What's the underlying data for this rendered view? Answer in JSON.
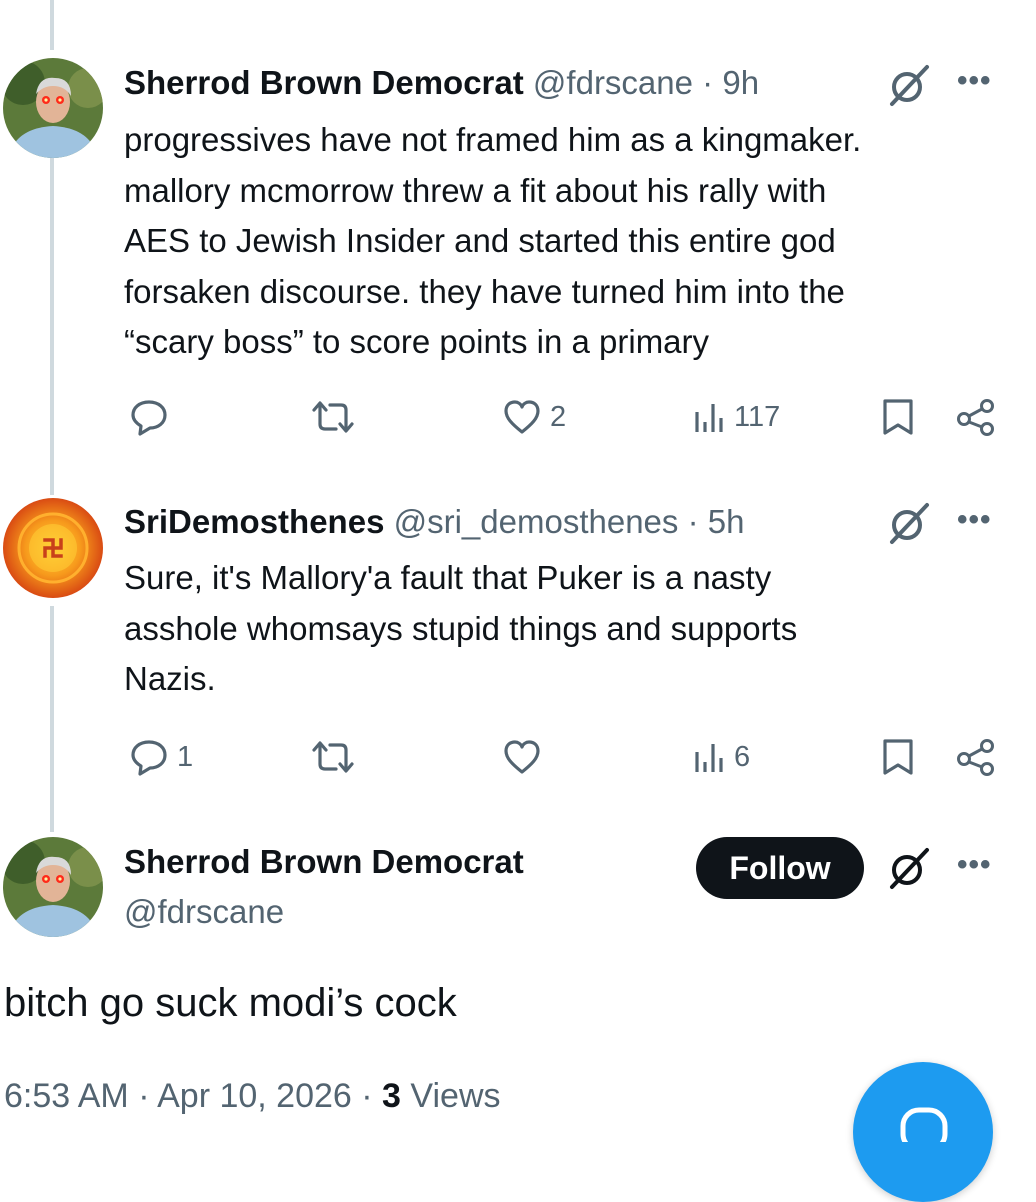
{
  "tweets": [
    {
      "name": "Sherrod Brown Democrat",
      "handle": "@fdrscane",
      "time": "9h",
      "text_lines": [
        "progressives have not framed him as a kingmaker.",
        "mallory mcmorrow threw a fit about his rally with",
        "AES to Jewish Insider and started this entire god",
        "forsaken discourse. they have turned him into the",
        "“scary boss” to score points in a primary"
      ],
      "replies": "",
      "reposts": "",
      "likes": "2",
      "views": "117"
    },
    {
      "name": "SriDemosthenes",
      "handle": "@sri_demosthenes",
      "time": "5h",
      "text_lines": [
        "Sure, it's Mallory'a fault that Puker is a nasty",
        "asshole whomsays stupid things and supports",
        "Nazis."
      ],
      "replies": "1",
      "reposts": "",
      "likes": "",
      "views": "6"
    }
  ],
  "main_post": {
    "name": "Sherrod Brown Democrat",
    "handle": "@fdrscane",
    "follow_label": "Follow",
    "text": "bitch go suck modi’s cock",
    "time": "6:53 AM",
    "date": "Apr 10, 2026",
    "views_count": "3",
    "views_label": "Views"
  },
  "separator": "·",
  "icons": {
    "reply": "reply-icon",
    "repost": "repost-icon",
    "like": "heart-icon",
    "views": "views-icon",
    "bookmark": "bookmark-icon",
    "share": "share-icon",
    "grok": "grok-icon",
    "more": "more-icon",
    "compose": "compose-icon"
  },
  "colors": {
    "text": "#0f1419",
    "muted": "#536471",
    "thread_line": "#cfd9de",
    "follow_bg": "#0f1419",
    "fab": "#1d9bf0"
  }
}
